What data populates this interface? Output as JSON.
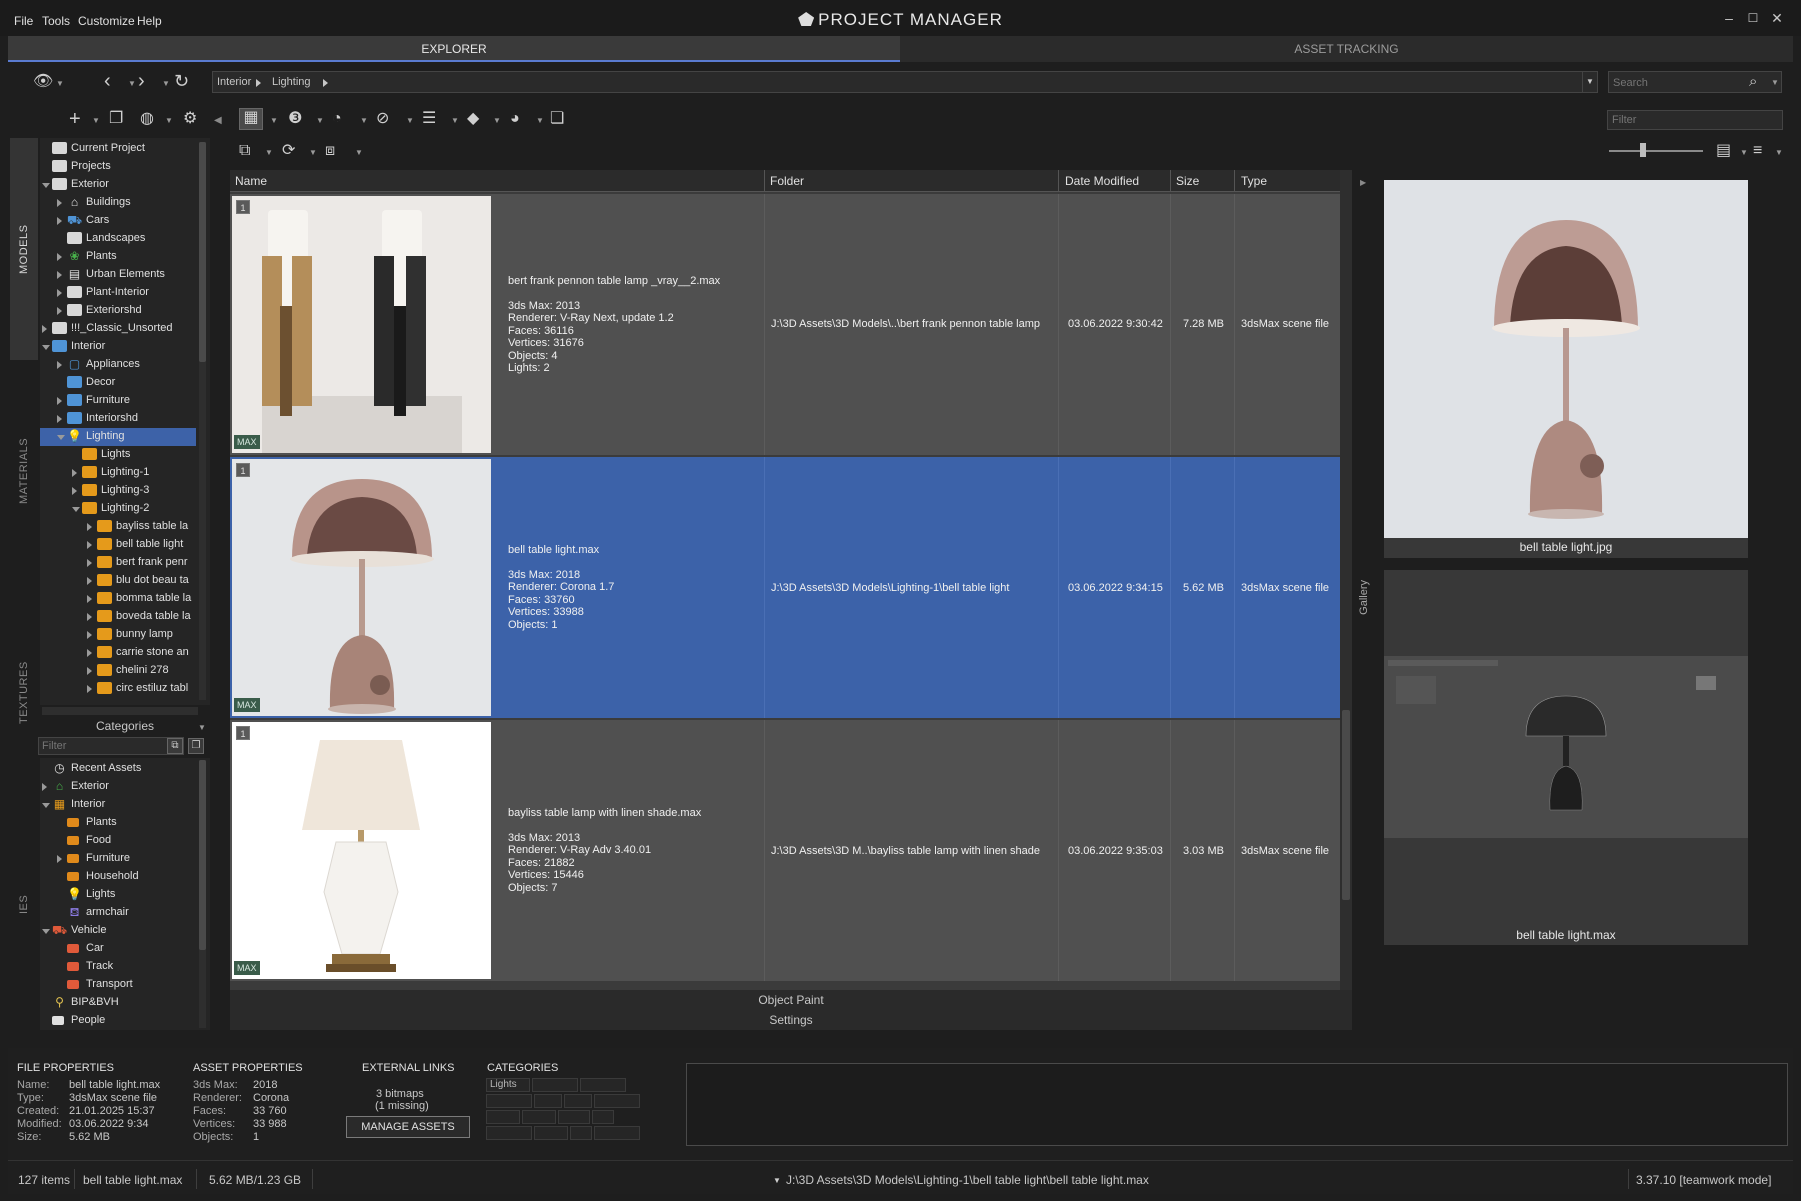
{
  "menu": [
    "File",
    "Tools",
    "Customize",
    "Help"
  ],
  "app_title": "PROJECT MANAGER",
  "window_controls": {
    "minimize": "–",
    "maximize": "☐",
    "close": "✕"
  },
  "tabs": {
    "explorer": "EXPLORER",
    "asset_tracking": "ASSET TRACKING"
  },
  "breadcrumb": [
    "Interior",
    "Lighting"
  ],
  "search": {
    "placeholder": "Search",
    "value": ""
  },
  "filter_top": {
    "placeholder": "Filter",
    "value": ""
  },
  "vertical_tabs": [
    "MODELS",
    "MATERIALS",
    "TEXTURES",
    "IES"
  ],
  "folder_tree": [
    {
      "label": "Current Project",
      "indent": 0,
      "twisty": "none",
      "icon": "folder-grey"
    },
    {
      "label": "Projects",
      "indent": 0,
      "twisty": "none",
      "icon": "folder-grey"
    },
    {
      "label": "Exterior",
      "indent": 0,
      "twisty": "open",
      "icon": "folder-grey"
    },
    {
      "label": "Buildings",
      "indent": 1,
      "twisty": "closed",
      "icon": "house-icon"
    },
    {
      "label": "Cars",
      "indent": 1,
      "twisty": "closed",
      "icon": "car-icon"
    },
    {
      "label": "Landscapes",
      "indent": 1,
      "twisty": "none",
      "icon": "folder-grey"
    },
    {
      "label": "Plants",
      "indent": 1,
      "twisty": "closed",
      "icon": "plant-icon"
    },
    {
      "label": "Urban Elements",
      "indent": 1,
      "twisty": "closed",
      "icon": "urban-icon"
    },
    {
      "label": "Plant-Interior",
      "indent": 1,
      "twisty": "closed",
      "icon": "folder-grey"
    },
    {
      "label": "Exteriorshd",
      "indent": 1,
      "twisty": "closed",
      "icon": "folder-grey"
    },
    {
      "label": "!!!_Classic_Unsorted",
      "indent": 0,
      "twisty": "closed",
      "icon": "folder-grey"
    },
    {
      "label": "Interior",
      "indent": 0,
      "twisty": "open",
      "icon": "folder-blue"
    },
    {
      "label": "Appliances",
      "indent": 1,
      "twisty": "closed",
      "icon": "appliance-icon"
    },
    {
      "label": "Decor",
      "indent": 1,
      "twisty": "none",
      "icon": "folder-blue"
    },
    {
      "label": "Furniture",
      "indent": 1,
      "twisty": "closed",
      "icon": "folder-blue"
    },
    {
      "label": "Interiorshd",
      "indent": 1,
      "twisty": "closed",
      "icon": "folder-blue"
    },
    {
      "label": "Lighting",
      "indent": 1,
      "twisty": "open",
      "icon": "bulb-icon",
      "selected": true
    },
    {
      "label": "Lights",
      "indent": 2,
      "twisty": "none",
      "icon": "folder-orange"
    },
    {
      "label": "Lighting-1",
      "indent": 2,
      "twisty": "closed",
      "icon": "folder-orange"
    },
    {
      "label": "Lighting-3",
      "indent": 2,
      "twisty": "closed",
      "icon": "folder-orange"
    },
    {
      "label": "Lighting-2",
      "indent": 2,
      "twisty": "open",
      "icon": "folder-orange"
    },
    {
      "label": "bayliss table la",
      "indent": 3,
      "twisty": "closed",
      "icon": "folder-orange"
    },
    {
      "label": "bell table light",
      "indent": 3,
      "twisty": "closed",
      "icon": "folder-orange"
    },
    {
      "label": "bert frank penr",
      "indent": 3,
      "twisty": "closed",
      "icon": "folder-orange"
    },
    {
      "label": "blu dot beau ta",
      "indent": 3,
      "twisty": "closed",
      "icon": "folder-orange"
    },
    {
      "label": "bomma table la",
      "indent": 3,
      "twisty": "closed",
      "icon": "folder-orange"
    },
    {
      "label": "boveda table la",
      "indent": 3,
      "twisty": "closed",
      "icon": "folder-orange"
    },
    {
      "label": "bunny lamp",
      "indent": 3,
      "twisty": "closed",
      "icon": "folder-orange"
    },
    {
      "label": "carrie stone an",
      "indent": 3,
      "twisty": "closed",
      "icon": "folder-orange"
    },
    {
      "label": "chelini 278",
      "indent": 3,
      "twisty": "closed",
      "icon": "folder-orange"
    },
    {
      "label": "circ estiluz tabl",
      "indent": 3,
      "twisty": "closed",
      "icon": "folder-orange"
    }
  ],
  "categories": {
    "header": "Categories",
    "filter_placeholder": "Filter",
    "items": [
      {
        "label": "Recent Assets",
        "indent": 0,
        "twisty": "none",
        "icon": "clock-icon"
      },
      {
        "label": "Exterior",
        "indent": 0,
        "twisty": "closed",
        "icon": "green-house-icon"
      },
      {
        "label": "Interior",
        "indent": 0,
        "twisty": "open",
        "icon": "orange-grid-icon"
      },
      {
        "label": "Plants",
        "indent": 1,
        "twisty": "none",
        "icon": "tag-orange"
      },
      {
        "label": "Food",
        "indent": 1,
        "twisty": "none",
        "icon": "tag-orange"
      },
      {
        "label": "Furniture",
        "indent": 1,
        "twisty": "closed",
        "icon": "tag-orange"
      },
      {
        "label": "Household",
        "indent": 1,
        "twisty": "none",
        "icon": "tag-orange"
      },
      {
        "label": "Lights",
        "indent": 1,
        "twisty": "none",
        "icon": "bulb-orange"
      },
      {
        "label": "armchair",
        "indent": 1,
        "twisty": "none",
        "icon": "armchair-icon"
      },
      {
        "label": "Vehicle",
        "indent": 0,
        "twisty": "open",
        "icon": "car-red-icon"
      },
      {
        "label": "Car",
        "indent": 1,
        "twisty": "none",
        "icon": "tag-red"
      },
      {
        "label": "Track",
        "indent": 1,
        "twisty": "none",
        "icon": "tag-red"
      },
      {
        "label": "Transport",
        "indent": 1,
        "twisty": "none",
        "icon": "tag-red"
      },
      {
        "label": "BIP&BVH",
        "indent": 0,
        "twisty": "none",
        "icon": "person-icon"
      },
      {
        "label": "People",
        "indent": 0,
        "twisty": "none",
        "icon": "tag-white"
      }
    ]
  },
  "columns": {
    "name": "Name",
    "folder": "Folder",
    "date": "Date Modified",
    "size": "Size",
    "type": "Type"
  },
  "assets": [
    {
      "index": "1",
      "badge": "MAX",
      "filename": "bert frank pennon table lamp _vray__2.max",
      "details": "3ds Max: 2013\nRenderer: V-Ray Next, update 1.2\nFaces: 36116\nVertices: 31676\nObjects: 4\nLights: 2",
      "folder": "J:\\3D Assets\\3D Models\\..\\bert frank pennon table lamp",
      "date": "03.06.2022 9:30:42",
      "size": "7.28 MB",
      "type": "3dsMax scene file"
    },
    {
      "index": "1",
      "badge": "MAX",
      "filename": "bell table light.max",
      "details": "3ds Max: 2018\nRenderer: Corona 1.7\nFaces: 33760\nVertices: 33988\nObjects: 1",
      "folder": "J:\\3D Assets\\3D Models\\Lighting-1\\bell table light",
      "date": "03.06.2022 9:34:15",
      "size": "5.62 MB",
      "type": "3dsMax scene file",
      "selected": true
    },
    {
      "index": "1",
      "badge": "MAX",
      "filename": "bayliss table lamp with linen shade.max",
      "details": "3ds Max: 2013\nRenderer: V-Ray Adv 3.40.01\nFaces: 21882\nVertices: 15446\nObjects: 7",
      "folder": "J:\\3D Assets\\3D M..\\bayliss table lamp with linen shade",
      "date": "03.06.2022 9:35:03",
      "size": "3.03 MB",
      "type": "3dsMax scene file"
    }
  ],
  "object_paint": "Object Paint",
  "settings": "Settings",
  "gallery": {
    "label": "Gallery",
    "items": [
      {
        "caption": "bell table light.jpg"
      },
      {
        "caption": "bell table light.max"
      }
    ]
  },
  "file_properties": {
    "title": "FILE PROPERTIES",
    "rows": [
      {
        "k": "Name:",
        "v": "bell table light.max"
      },
      {
        "k": "Type:",
        "v": "3dsMax scene file"
      },
      {
        "k": "Created:",
        "v": "21.01.2025 15:37"
      },
      {
        "k": "Modified:",
        "v": "03.06.2022 9:34"
      },
      {
        "k": "Size:",
        "v": "5.62 MB"
      }
    ]
  },
  "asset_properties": {
    "title": "ASSET PROPERTIES",
    "rows": [
      {
        "k": "3ds Max:",
        "v": "2018"
      },
      {
        "k": "Renderer:",
        "v": "Corona"
      },
      {
        "k": "Faces:",
        "v": "33 760"
      },
      {
        "k": "Vertices:",
        "v": "33 988"
      },
      {
        "k": "Objects:",
        "v": "1"
      }
    ]
  },
  "external_links": {
    "title": "EXTERNAL LINKS",
    "bitmaps": "3 bitmaps",
    "missing": "(1 missing)",
    "button": "MANAGE ASSETS"
  },
  "categories_props": {
    "title": "CATEGORIES",
    "chip": "Lights"
  },
  "status": {
    "items": "127 items",
    "selected": "bell table light.max",
    "size": "5.62 MB/1.23 GB",
    "path": "J:\\3D Assets\\3D Models\\Lighting-1\\bell table light\\bell table light.max",
    "version": "3.37.10 [teamwork mode]"
  },
  "colors": {
    "selection": "#3c62a9",
    "tree_selection": "#3d62a8",
    "row_bg": "#505050"
  }
}
